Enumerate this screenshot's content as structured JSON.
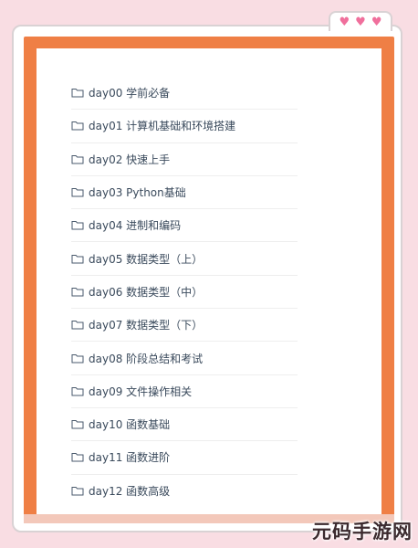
{
  "folders": [
    {
      "label": "day00 学前必备"
    },
    {
      "label": "day01 计算机基础和环境搭建"
    },
    {
      "label": "day02 快速上手"
    },
    {
      "label": "day03 Python基础"
    },
    {
      "label": "day04 进制和编码"
    },
    {
      "label": "day05 数据类型（上）"
    },
    {
      "label": "day06 数据类型（中）"
    },
    {
      "label": "day07 数据类型（下）"
    },
    {
      "label": "day08 阶段总结和考试"
    },
    {
      "label": "day09 文件操作相关"
    },
    {
      "label": "day10 函数基础"
    },
    {
      "label": "day11 函数进阶"
    },
    {
      "label": "day12 函数高级"
    }
  ],
  "icons": {
    "folder": "folder-icon",
    "heart": "heart-icon"
  },
  "colors": {
    "frame": "#ef7f45",
    "background": "#f9dde3",
    "heart": "#f06f9c",
    "text": "#3a4a5c"
  },
  "watermark": "元码手游网"
}
